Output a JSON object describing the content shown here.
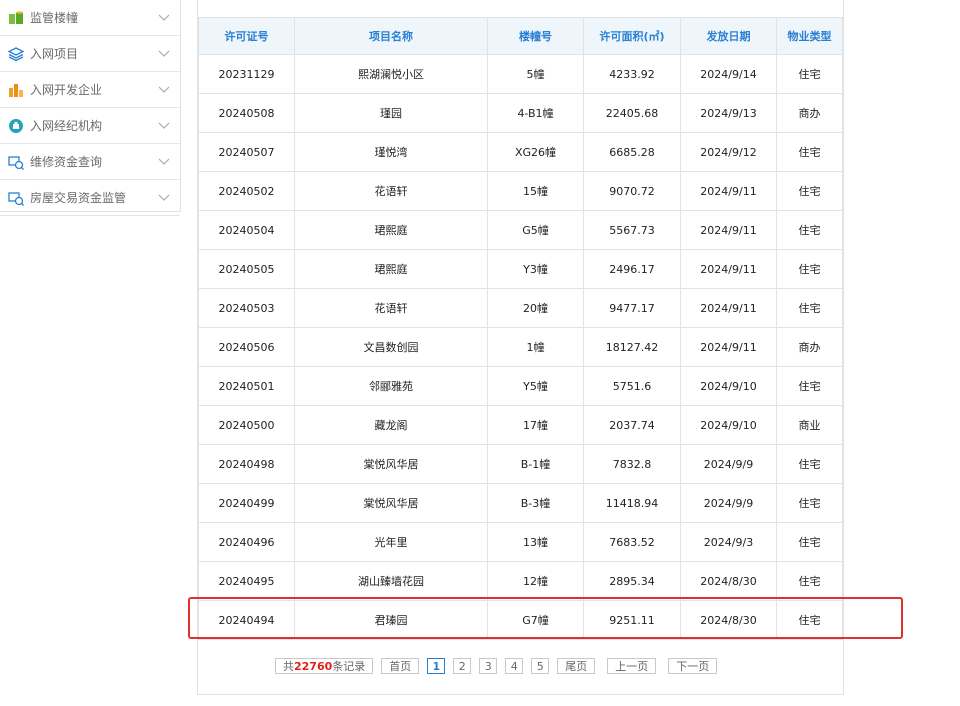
{
  "sidebar": {
    "items": [
      {
        "label": "监管楼幢",
        "icon": "building-coins-icon"
      },
      {
        "label": "入网项目",
        "icon": "layers-icon"
      },
      {
        "label": "入网开发企业",
        "icon": "bar-chart-icon"
      },
      {
        "label": "入网经纪机构",
        "icon": "agency-icon"
      },
      {
        "label": "维修资金查询",
        "icon": "fund-query-icon"
      },
      {
        "label": "房屋交易资金监管",
        "icon": "fund-supervision-icon"
      }
    ]
  },
  "table": {
    "headers": [
      "许可证号",
      "项目名称",
      "楼幢号",
      "许可面积(㎡)",
      "发放日期",
      "物业类型"
    ],
    "rows": [
      [
        "20231129",
        "熙湖澜悦小区",
        "5幢",
        "4233.92",
        "2024/9/14",
        "住宅"
      ],
      [
        "20240508",
        "瑾园",
        "4-B1幢",
        "22405.68",
        "2024/9/13",
        "商办"
      ],
      [
        "20240507",
        "瑾悦湾",
        "XG26幢",
        "6685.28",
        "2024/9/12",
        "住宅"
      ],
      [
        "20240502",
        "花语轩",
        "15幢",
        "9070.72",
        "2024/9/11",
        "住宅"
      ],
      [
        "20240504",
        "珺熙庭",
        "G5幢",
        "5567.73",
        "2024/9/11",
        "住宅"
      ],
      [
        "20240505",
        "珺熙庭",
        "Y3幢",
        "2496.17",
        "2024/9/11",
        "住宅"
      ],
      [
        "20240503",
        "花语轩",
        "20幢",
        "9477.17",
        "2024/9/11",
        "住宅"
      ],
      [
        "20240506",
        "文昌数创园",
        "1幢",
        "18127.42",
        "2024/9/11",
        "商办"
      ],
      [
        "20240501",
        "邻郦雅苑",
        "Y5幢",
        "5751.6",
        "2024/9/10",
        "住宅"
      ],
      [
        "20240500",
        "藏龙阁",
        "17幢",
        "2037.74",
        "2024/9/10",
        "商业"
      ],
      [
        "20240498",
        "棠悦风华居",
        "B-1幢",
        "7832.8",
        "2024/9/9",
        "住宅"
      ],
      [
        "20240499",
        "棠悦风华居",
        "B-3幢",
        "11418.94",
        "2024/9/9",
        "住宅"
      ],
      [
        "20240496",
        "光年里",
        "13幢",
        "7683.52",
        "2024/9/3",
        "住宅"
      ],
      [
        "20240495",
        "湖山臻墙花园",
        "12幢",
        "2895.34",
        "2024/8/30",
        "住宅"
      ],
      [
        "20240494",
        "君瑧园",
        "G7幢",
        "9251.11",
        "2024/8/30",
        "住宅"
      ]
    ]
  },
  "pager": {
    "total_prefix": "共",
    "total_count": "22760",
    "total_suffix": "条记录",
    "first": "首页",
    "pages": [
      "1",
      "2",
      "3",
      "4",
      "5"
    ],
    "active_page": "1",
    "last": "尾页",
    "prev": "上一页",
    "next": "下一页"
  },
  "colors": {
    "accent": "#2a7fd4",
    "header_bg": "#eef6fb",
    "highlight": "#e03030",
    "total_count": "#e0201b"
  }
}
